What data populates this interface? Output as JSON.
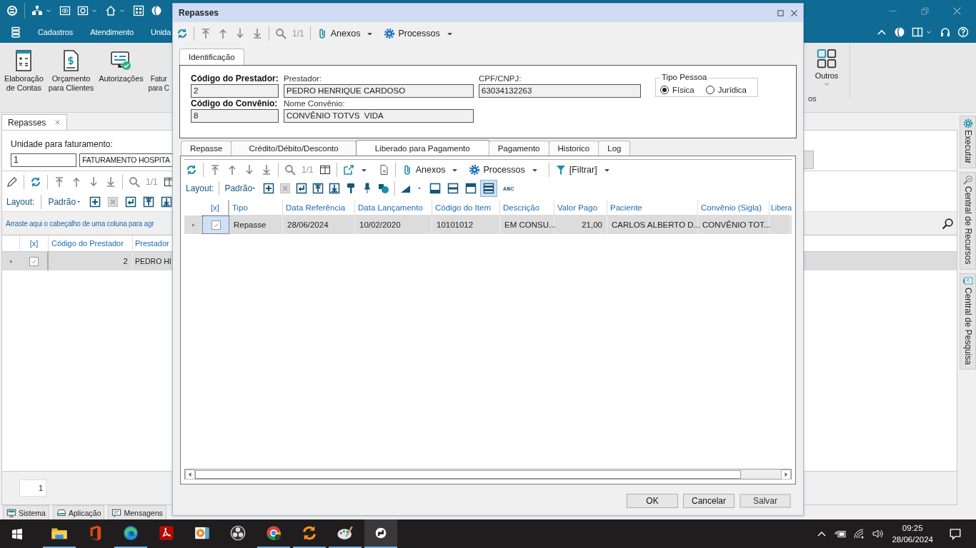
{
  "app": {
    "menu": [
      "Cadastros",
      "Atendimento",
      "Unida"
    ],
    "ribbon": [
      {
        "kind": "calc",
        "label": "Elaboração\nde Contas"
      },
      {
        "kind": "doc",
        "label": "Orçamento\npara Clientes"
      },
      {
        "kind": "auth",
        "label": "Autorizações"
      },
      {
        "kind": "cut",
        "label": "Fatur\npara C"
      }
    ],
    "ribbon_right": {
      "label": "Outros",
      "group": "os"
    },
    "doc_tab": {
      "label": "Repasses"
    },
    "unidade": {
      "label": "Unidade para faturamento:",
      "code": "1",
      "name": "FATURAMENTO HOSPITA"
    },
    "pager": "1/1",
    "layout": {
      "label": "Layout:",
      "value": "Padrão"
    },
    "group_hint": "Arraste aqui o cabeçalho de uma coluna para agr",
    "grid": {
      "columns": [
        "[x]",
        "Código do Prestador",
        "Prestador"
      ],
      "rows": [
        {
          "checked": true,
          "selected": true,
          "code": "2",
          "name": "PEDRO HI"
        }
      ]
    },
    "page_field": "1",
    "bottom_tabs": [
      {
        "kind": "monitor",
        "label": "Sistema"
      },
      {
        "kind": "drive",
        "label": "Aplicação"
      },
      {
        "kind": "chat",
        "label": "Mensagens"
      }
    ],
    "side_tabs": [
      {
        "kind": "gear",
        "label": "Executar"
      },
      {
        "kind": "search",
        "label": "Central de Recursos"
      },
      {
        "kind": "screen",
        "label": "Central de Pesquisa"
      }
    ]
  },
  "dialog": {
    "title": "Repasses",
    "pager": "1/1",
    "anexos": "Anexos",
    "processos": "Processos",
    "id_tab": "Identificação",
    "fields": [
      {
        "label": "Código do Prestador:",
        "bold": true,
        "value": "2"
      },
      {
        "label": "Prestador:",
        "bold": false,
        "value": "PEDRO HENRIQUE CARDOSO"
      },
      {
        "label": "CPF/CNPJ:",
        "bold": false,
        "value": "63034132263"
      },
      {
        "label": "Código do Convênio:",
        "bold": true,
        "value": "8"
      },
      {
        "label": "Nome Convênio:",
        "bold": false,
        "value": "CONVÊNIO TOTVS  VIDA"
      }
    ],
    "tipo_pessoa": {
      "label": "Tipo Pessoa",
      "options": [
        {
          "label": "Física",
          "selected": true
        },
        {
          "label": "Jurídica",
          "selected": false
        }
      ]
    },
    "tabs": [
      {
        "label": "Repasse",
        "selected": false
      },
      {
        "label": "Crédito/Débito/Desconto",
        "selected": false
      },
      {
        "label": "Liberado para Pagamento",
        "selected": true
      },
      {
        "label": "Pagamento",
        "selected": false
      },
      {
        "label": "Historico",
        "selected": false
      },
      {
        "label": "Log",
        "selected": false
      }
    ],
    "inner_pager": "1/1",
    "inner_anexos": "Anexos",
    "inner_processos": "Processos",
    "filter": "[Filtrar]",
    "layout": {
      "label": "Layout:",
      "value": "Padrão"
    },
    "view_buttons": [
      {
        "selected": false
      },
      {
        "selected": false
      },
      {
        "selected": false
      },
      {
        "selected": true
      }
    ],
    "abc": "ABC",
    "table": {
      "columns": [
        "[x]",
        "Tipo",
        "Data Referência",
        "Data Lançamento",
        "Código do Item",
        "Descrição",
        "Valor Pago",
        "Paciente",
        "Convênio (Sigla)",
        "Libera"
      ],
      "rows": [
        {
          "checked": true,
          "selected": true,
          "cells": [
            "",
            "Repasse",
            "28/06/2024",
            "10/02/2020",
            "10101012",
            "EM CONSU...",
            "21,00",
            "CARLOS ALBERTO D...",
            "CONVÊNIO TOT...",
            ""
          ]
        }
      ]
    },
    "buttons": [
      "OK",
      "Cancelar",
      "Salvar"
    ]
  },
  "taskbar": {
    "apps": [
      {
        "kind": "folder",
        "running": true,
        "active": false
      },
      {
        "kind": "office",
        "running": false,
        "active": false
      },
      {
        "kind": "edge",
        "running": true,
        "active": false
      },
      {
        "kind": "acrobat",
        "running": false,
        "active": false
      },
      {
        "kind": "media",
        "running": false,
        "active": false
      },
      {
        "kind": "obs",
        "running": false,
        "active": false
      },
      {
        "kind": "chrome",
        "running": true,
        "active": false
      },
      {
        "kind": "sync",
        "running": true,
        "active": false
      },
      {
        "kind": "paint",
        "running": true,
        "active": false
      },
      {
        "kind": "totvs",
        "running": true,
        "active": true
      }
    ],
    "time": "09:25",
    "date": "28/06/2024"
  }
}
